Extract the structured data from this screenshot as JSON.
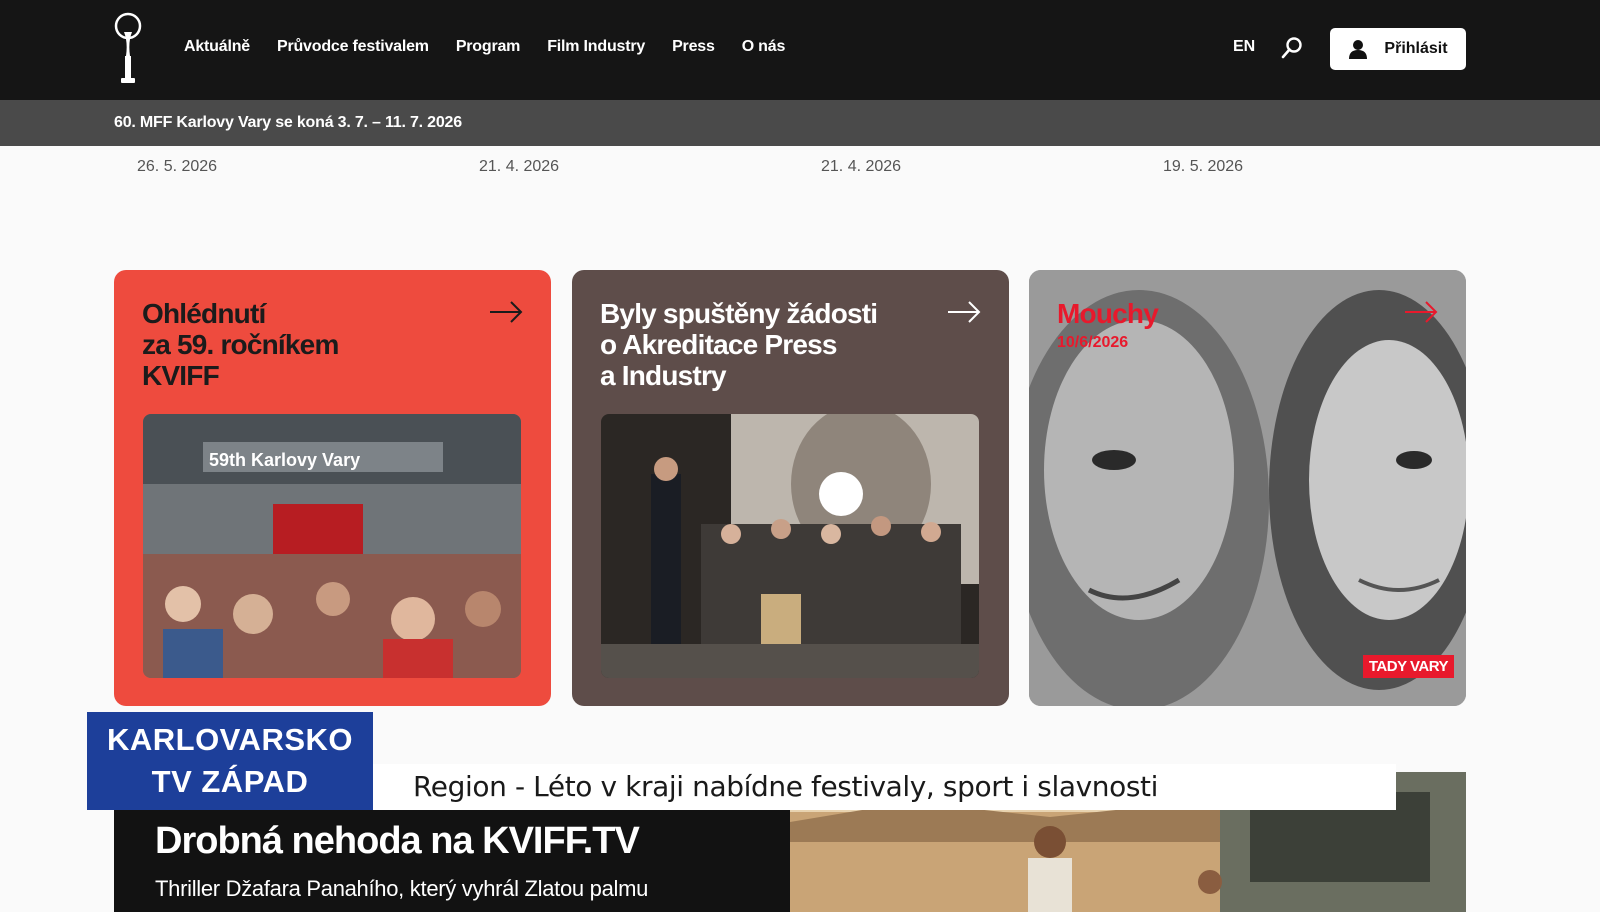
{
  "header": {
    "nav": [
      "Aktuálně",
      "Průvodce festivalem",
      "Program",
      "Film Industry",
      "Press",
      "O nás"
    ],
    "lang": "EN",
    "login_label": "Přihlásit"
  },
  "announcement": "60. MFF Karlovy Vary se koná 3. 7. – 11. 7. 2026",
  "news_dates": [
    "26. 5. 2026",
    "21. 4. 2026",
    "21. 4. 2026",
    "19. 5. 2026"
  ],
  "cards": [
    {
      "title_lines": [
        "Ohlédnutí",
        "za 59. ročníkem",
        "KVIFF"
      ],
      "photo_banner": "59th Karlovy Vary"
    },
    {
      "title_lines": [
        "Byly spuštěny žádosti",
        "o Akreditace Press",
        "a Industry"
      ]
    },
    {
      "title": "Mouchy",
      "date": "10/6/2026",
      "badge": "TADY VARY"
    }
  ],
  "featured": {
    "title": "Drobná nehoda na KVIFF.TV",
    "subtitle": "Thriller Džafara Panahího, který vyhrál Zlatou palmu"
  },
  "tv_overlay": {
    "logo_line1": "KARLOVARSKO",
    "logo_line2": "TV ZÁPAD",
    "headline": "Region - Léto v kraji nabídne festivaly, sport i slavnosti"
  },
  "colors": {
    "accent_red": "#ee4b3e",
    "card_brown": "#5e4d4a",
    "tv_blue": "#1d3f9a"
  }
}
